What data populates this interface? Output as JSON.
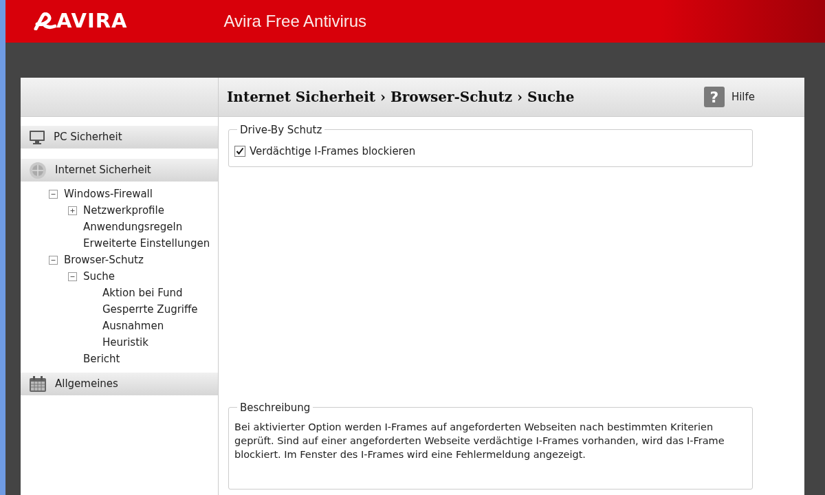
{
  "header": {
    "logo": "AVIRA",
    "title": "Avira Free Antivirus"
  },
  "sidebar": {
    "sections": [
      {
        "label": "PC Sicherheit"
      },
      {
        "label": "Internet Sicherheit",
        "children": [
          {
            "label": "Windows-Firewall",
            "expanded": true,
            "children": [
              {
                "label": "Netzwerkprofile",
                "expanded": false
              },
              {
                "label": "Anwendungsregeln"
              },
              {
                "label": "Erweiterte Einstellungen"
              }
            ]
          },
          {
            "label": "Browser-Schutz",
            "expanded": true,
            "children": [
              {
                "label": "Suche",
                "expanded": true,
                "children": [
                  {
                    "label": "Aktion bei Fund"
                  },
                  {
                    "label": "Gesperrte Zugriffe"
                  },
                  {
                    "label": "Ausnahmen"
                  },
                  {
                    "label": "Heuristik"
                  }
                ]
              },
              {
                "label": "Bericht"
              }
            ]
          }
        ]
      },
      {
        "label": "Allgemeines"
      }
    ]
  },
  "content": {
    "breadcrumb": "Internet Sicherheit › Browser-Schutz › Suche",
    "help_icon": "?",
    "help": "Hilfe",
    "group": {
      "title": "Drive-By Schutz",
      "options": [
        {
          "label": "Verdächtige I-Frames blockieren",
          "checked": true
        }
      ]
    },
    "description": {
      "title": "Beschreibung",
      "text": "Bei aktivierter Option werden I-Frames auf angeforderten Webseiten nach bestimmten Kriterien geprüft. Sind auf einer angeforderten Webseite verdächtige I-Frames vorhanden, wird das I-Frame blockiert. Im Fenster des I-Frames wird eine Fehlermeldung angezeigt."
    }
  }
}
